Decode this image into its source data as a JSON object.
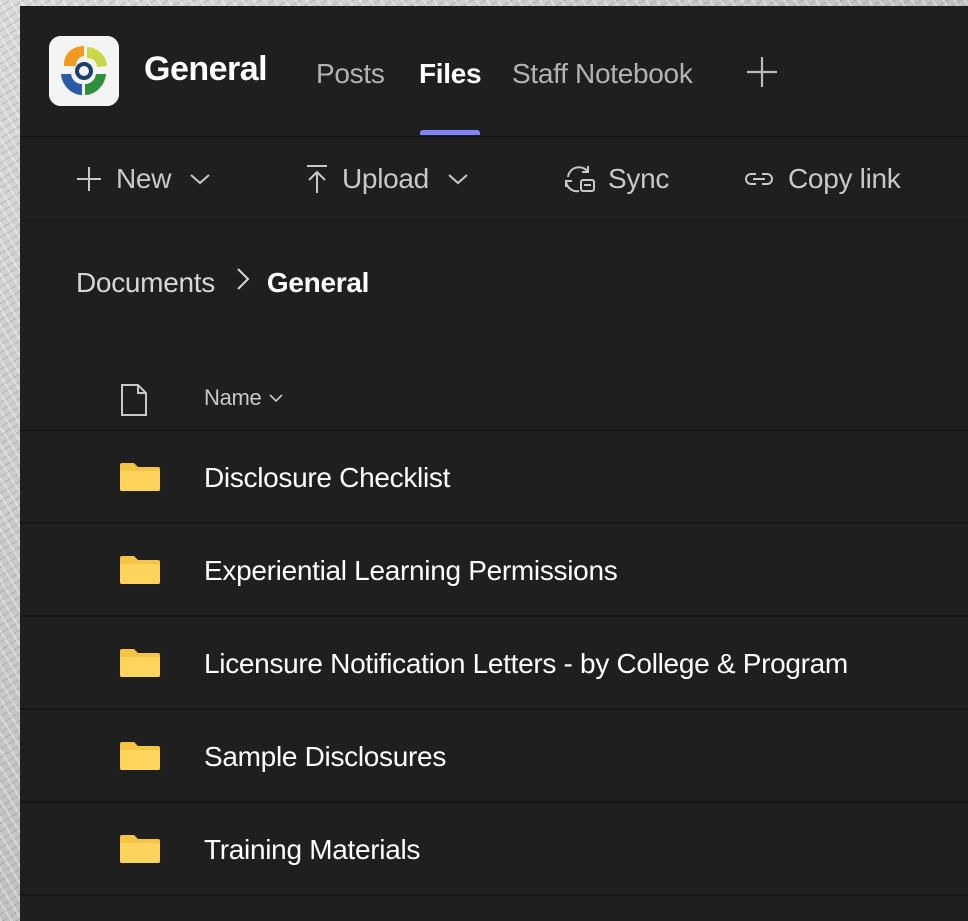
{
  "header": {
    "team_name": "General",
    "tabs": [
      {
        "label": "Posts",
        "active": false
      },
      {
        "label": "Files",
        "active": true
      },
      {
        "label": "Staff Notebook",
        "active": false
      }
    ],
    "add_tab_icon": "plus-icon",
    "accent_color": "#7f85f5"
  },
  "toolbar": {
    "new_label": "New",
    "upload_label": "Upload",
    "sync_label": "Sync",
    "copy_link_label": "Copy link"
  },
  "breadcrumb": {
    "root": "Documents",
    "separator_icon": "chevron-right-icon",
    "current": "General"
  },
  "list": {
    "name_header": "Name",
    "rows": [
      {
        "name": "Disclosure Checklist",
        "type": "folder"
      },
      {
        "name": "Experiential Learning Permissions",
        "type": "folder"
      },
      {
        "name": "Licensure Notification Letters - by College & Program",
        "type": "folder"
      },
      {
        "name": "Sample Disclosures",
        "type": "folder"
      },
      {
        "name": "Training Materials",
        "type": "folder"
      }
    ],
    "folder_color": "#f6c443"
  }
}
